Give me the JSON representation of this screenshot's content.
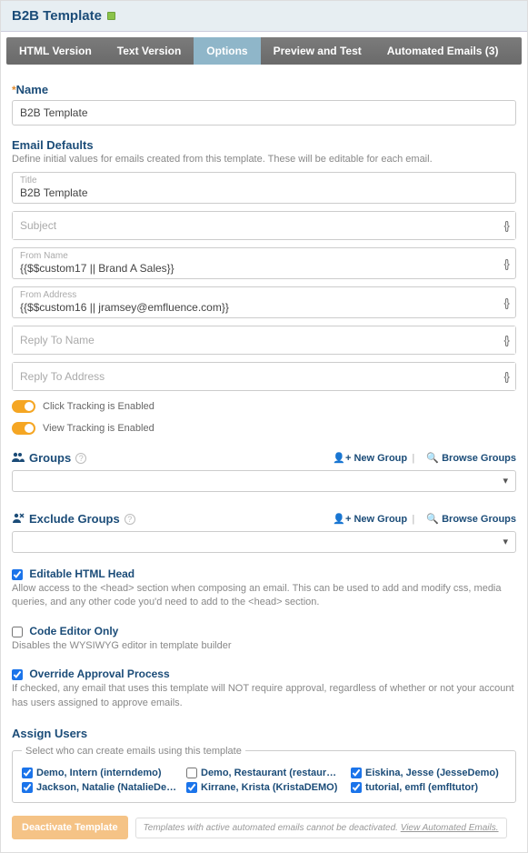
{
  "header": {
    "title": "B2B Template"
  },
  "tabs": [
    {
      "label": "HTML Version"
    },
    {
      "label": "Text Version"
    },
    {
      "label": "Options"
    },
    {
      "label": "Preview and Test"
    },
    {
      "label": "Automated Emails (3)"
    }
  ],
  "name": {
    "label": "Name",
    "value": "B2B Template"
  },
  "defaults": {
    "heading": "Email Defaults",
    "desc": "Define initial values for emails created from this template. These will be editable for each email.",
    "title_label": "Title",
    "title_value": "B2B Template",
    "subject_placeholder": "Subject",
    "fromname_label": "From Name",
    "fromname_value": "{{$$custom17 || Brand A Sales}}",
    "fromaddr_label": "From Address",
    "fromaddr_value": "{{$$custom16 || jramsey@emfluence.com}}",
    "replyname_placeholder": "Reply To Name",
    "replyaddr_placeholder": "Reply To Address"
  },
  "toggles": {
    "click": "Click Tracking is Enabled",
    "view": "View Tracking is Enabled"
  },
  "groups": {
    "label": "Groups",
    "exclude_label": "Exclude Groups",
    "new_group": "New Group",
    "browse_groups": "Browse Groups"
  },
  "checks": {
    "editable_head_label": "Editable HTML Head",
    "editable_head_desc": "Allow access to the <head> section when composing an email. This can be used to add and modify css, media queries, and any other code you'd need to add to the <head> section.",
    "code_editor_label": "Code Editor Only",
    "code_editor_desc": "Disables the WYSIWYG editor in template builder",
    "override_label": "Override Approval Process",
    "override_desc": "If checked, any email that uses this template will NOT require approval, regardless of whether or not your account has users assigned to approve emails."
  },
  "assign": {
    "heading": "Assign Users",
    "legend": "Select who can create emails using this template",
    "users": [
      {
        "label": "Demo, Intern (interndemo)",
        "checked": true
      },
      {
        "label": "Demo, Restaurant (restaurantdemo)",
        "checked": false
      },
      {
        "label": "Eiskina, Jesse (JesseDemo)",
        "checked": true
      },
      {
        "label": "Jackson, Natalie (NatalieDemo)",
        "checked": true
      },
      {
        "label": "Kirrane, Krista (KristaDEMO)",
        "checked": true
      },
      {
        "label": "tutorial, emfl (emfltutor)",
        "checked": true
      }
    ]
  },
  "footer": {
    "button": "Deactivate Template",
    "note_prefix": "Templates with active automated emails cannot be deactivated. ",
    "note_link": "View Automated Emails."
  }
}
